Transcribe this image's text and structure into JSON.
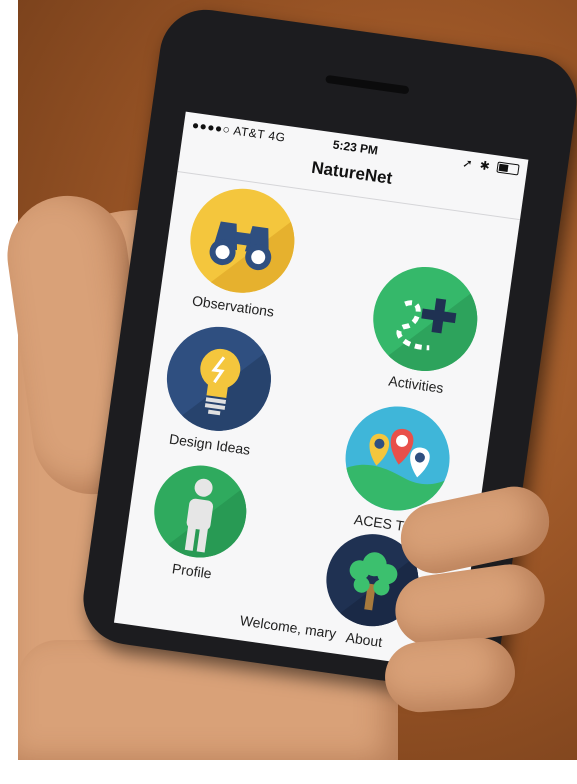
{
  "status_bar": {
    "carrier": "●●●●○ AT&T  4G",
    "time": "5:23 PM",
    "indicators": "➚ ✱"
  },
  "nav": {
    "title": "NatureNet"
  },
  "tiles": [
    {
      "label": "Observations",
      "icon": "binoculars-icon",
      "color": "#f4c63d"
    },
    {
      "label": "Activities",
      "icon": "trail-map-icon",
      "color": "#35b86a"
    },
    {
      "label": "Design Ideas",
      "icon": "lightbulb-icon",
      "color": "#2f4f80"
    },
    {
      "label": "ACES Tour",
      "icon": "map-pins-icon",
      "color": "#3fb6d9"
    },
    {
      "label": "Profile",
      "icon": "person-icon",
      "color": "#2faa5e"
    },
    {
      "label": "About",
      "icon": "tree-icon",
      "color": "#1f3152"
    }
  ],
  "footer": {
    "welcome": "Welcome, mary"
  }
}
